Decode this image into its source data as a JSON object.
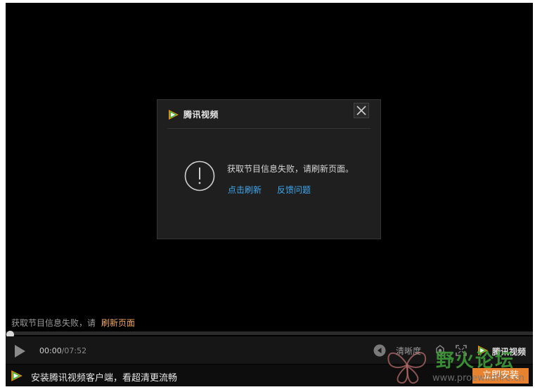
{
  "dialog": {
    "brand": "腾讯视频",
    "message": "获取节目信息失败，请刷新页面。",
    "refresh_link": "点击刷新",
    "feedback_link": "反馈问题"
  },
  "status": {
    "text": "获取节目信息失败，请",
    "link": "刷新页面"
  },
  "player": {
    "progress": 0,
    "time_current": "00:00",
    "time_total": "/07:52",
    "quality_label": "清晰度",
    "brand": "腾讯视频"
  },
  "banner": {
    "text": "安装腾讯视频客户端，看超清更流畅",
    "install_label": "立即安装"
  },
  "watermark": {
    "title": "野火论坛",
    "url": "www.proewildfire.cn"
  },
  "colors": {
    "link_blue": "#3fa8ef",
    "accent_orange": "#e8822e"
  }
}
